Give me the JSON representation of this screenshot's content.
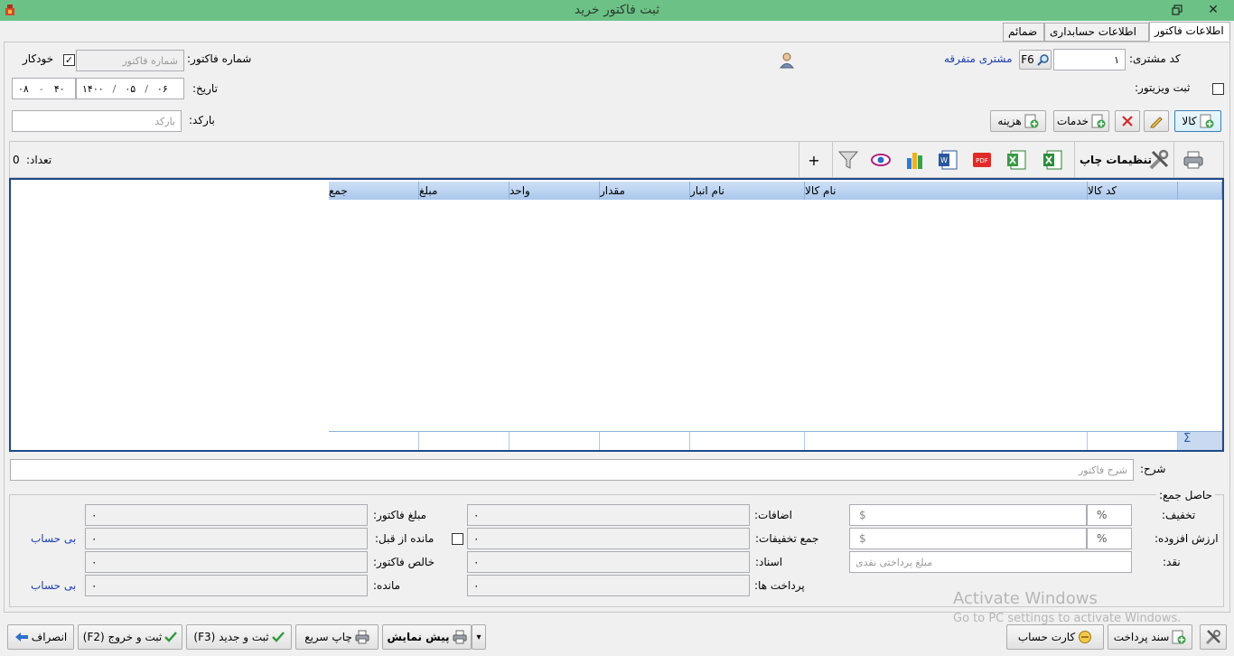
{
  "window": {
    "title": "ثبت فاکتور خرید",
    "minimize_glyph": "▭",
    "close_glyph": "✕",
    "icons": [
      "restore-icon",
      "close-icon",
      "app-icon"
    ]
  },
  "tabs": [
    {
      "label": "اطلاعات فاکتور",
      "active": true
    },
    {
      "label": "اطلاعات حسابداری",
      "active": false
    },
    {
      "label": "ضمائم",
      "active": false
    }
  ],
  "header": {
    "customer_code_label": "کد مشتری:",
    "customer_code_value": "۱",
    "lookup_key": "F6",
    "customer_name": "مشتری متفرقه",
    "invoice_number_label": "شماره فاکتور:",
    "invoice_number_placeholder": "شماره فاکتور",
    "auto_label": "خودکار",
    "auto_checked": "✓",
    "visitor_label": "ثبت ویزیتور:",
    "date_label": "تاریخ:",
    "date_year": "۱۴۰۰",
    "date_month": "۰۵",
    "date_day": "۰۶",
    "time_min": "۴۰",
    "time_hour": "۰۸",
    "date_sep": "/",
    "time_sep": "-",
    "barcode_label": "بارکد:",
    "barcode_placeholder": "بارکد"
  },
  "actions": {
    "goods": "کالا",
    "services": "خدمات",
    "expense": "هزینه"
  },
  "toolbar": {
    "print_settings": "تنظیمات چاپ",
    "plus": "+",
    "count_label": "تعداد:",
    "count_value": "0",
    "pdf_text": "PDF",
    "word_text": "W"
  },
  "grid": {
    "columns": [
      "کد کالا",
      "نام کالا",
      "نام انبار",
      "مقدار",
      "واحد",
      "مبلغ",
      "جمع"
    ],
    "sum_symbol": "Σ",
    "rows": []
  },
  "description": {
    "label": "شرح:",
    "placeholder": "شرح فاکتور"
  },
  "totals": {
    "group_label": "حاصل جمع:",
    "discount_label": "تخفیف:",
    "vat_label": "ارزش افزوده:",
    "cash_label": "نقد:",
    "cash_placeholder": "مبلغ پرداختی نقدی",
    "percent": "%",
    "currency": "$",
    "additions_label": "اضافات:",
    "total_discounts_label": "جمع تخفیفات:",
    "documents_label": "اسناد:",
    "payments_label": "پرداخت ها:",
    "invoice_amount_label": "مبلغ فاکتور:",
    "previous_balance_label": "مانده از قبل:",
    "net_invoice_label": "خالص فاکتور:",
    "balance_label": "مانده:",
    "no_account_1": "بی حساب",
    "no_account_2": "بی حساب",
    "zero": "۰"
  },
  "watermark": {
    "line1": "Activate Windows",
    "line2": "Go to PC settings to activate Windows."
  },
  "footer": {
    "payment_doc": "سند پرداخت",
    "account_card": "کارت حساب",
    "preview": "پیش نمایش",
    "dropdown_glyph": "▾",
    "quick_print": "چاپ سریع",
    "save_new": "ثبت و جدید (F3)",
    "save_exit": "ثبت و خروج (F2)",
    "cancel": "انصراف"
  }
}
